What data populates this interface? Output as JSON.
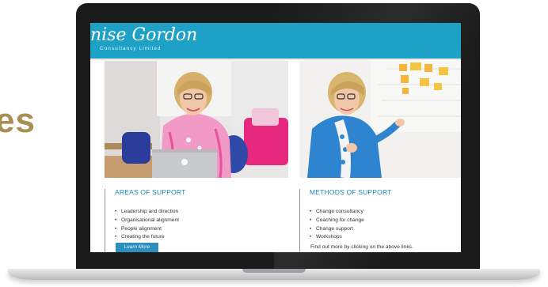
{
  "page_side_text": "es",
  "site": {
    "logo_name": "nise Gordon",
    "logo_sub": "Consultancy Limited",
    "header_color": "#1ea1c6"
  },
  "areas": {
    "title": "AREAS OF SUPPORT",
    "items": [
      "Leadership and direction",
      "Organisational alignment",
      "People alignment",
      "Creating the future"
    ],
    "button_label": "Learn More"
  },
  "methods": {
    "title": "METHODS OF SUPPORT",
    "items": [
      "Change consultancy",
      "Coaching for change",
      "Change support",
      "Workshops"
    ],
    "footer_text": "Find out more by clicking on the above links."
  }
}
